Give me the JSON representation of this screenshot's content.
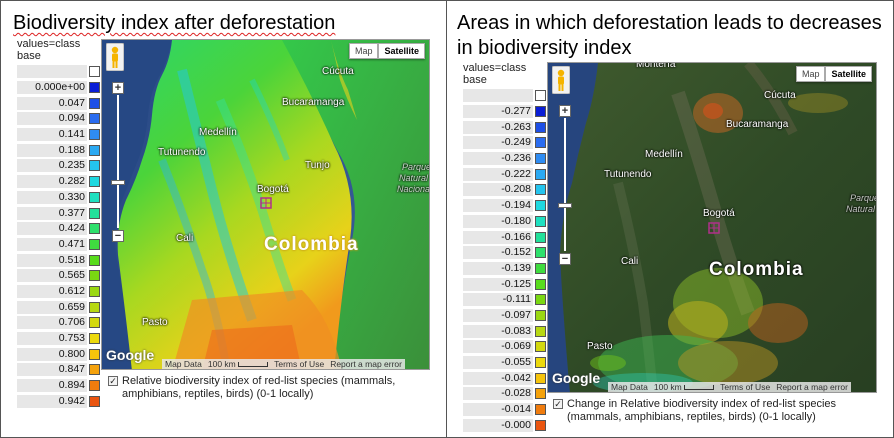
{
  "left_panel": {
    "title": "Biodiversity index after deforestation",
    "legend_header": "values=class base",
    "legend": [
      {
        "value": "",
        "color": "#ffffff"
      },
      {
        "value": "0.000e+00",
        "color": "#0a1ed6"
      },
      {
        "value": "0.047",
        "color": "#1e4fe6"
      },
      {
        "value": "0.094",
        "color": "#2a6cf0"
      },
      {
        "value": "0.141",
        "color": "#2f8cf2"
      },
      {
        "value": "0.188",
        "color": "#2aa9f2"
      },
      {
        "value": "0.235",
        "color": "#24c4ee"
      },
      {
        "value": "0.282",
        "color": "#1ed8e0"
      },
      {
        "value": "0.330",
        "color": "#1fe0c0"
      },
      {
        "value": "0.377",
        "color": "#22e09a"
      },
      {
        "value": "0.424",
        "color": "#2ee06c"
      },
      {
        "value": "0.471",
        "color": "#3fdc3f"
      },
      {
        "value": "0.518",
        "color": "#58dc1c"
      },
      {
        "value": "0.565",
        "color": "#7ad812"
      },
      {
        "value": "0.612",
        "color": "#9ad812"
      },
      {
        "value": "0.659",
        "color": "#b7d812"
      },
      {
        "value": "0.706",
        "color": "#d3d80e"
      },
      {
        "value": "0.753",
        "color": "#ecd90c"
      },
      {
        "value": "0.800",
        "color": "#f6c40c"
      },
      {
        "value": "0.847",
        "color": "#f5a20c"
      },
      {
        "value": "0.894",
        "color": "#f07c0e"
      },
      {
        "value": "0.942",
        "color": "#ea5510"
      }
    ],
    "map": {
      "type_buttons": [
        "Map",
        "Satellite"
      ],
      "selected_type": "Satellite",
      "cities": [
        "Cúcuta",
        "Bucaramanga",
        "Medellín",
        "Tunjo",
        "Tutunendo",
        "Bogotá",
        "Cali",
        "Pasto"
      ],
      "country": "Colombia",
      "faint_labels": [
        "Parque",
        "Natural",
        "Nacional"
      ],
      "google_logo": "Google",
      "attribution": [
        "Map Data",
        "100 km",
        "Terms of Use",
        "Report a map error"
      ]
    },
    "layer_caption": "Relative biodiversity index of red-list species (mammals, amphibians, reptiles, birds) (0-1 locally)"
  },
  "right_panel": {
    "title": "Areas in which deforestation leads to decreases in biodiversity index",
    "legend_header": "values=class base",
    "legend": [
      {
        "value": "",
        "color": "#ffffff"
      },
      {
        "value": "-0.277",
        "color": "#0a1ed6"
      },
      {
        "value": "-0.263",
        "color": "#1e4fe6"
      },
      {
        "value": "-0.249",
        "color": "#2a6cf0"
      },
      {
        "value": "-0.236",
        "color": "#2f8cf2"
      },
      {
        "value": "-0.222",
        "color": "#2aa9f2"
      },
      {
        "value": "-0.208",
        "color": "#24c4ee"
      },
      {
        "value": "-0.194",
        "color": "#1ed8e0"
      },
      {
        "value": "-0.180",
        "color": "#1fe0c0"
      },
      {
        "value": "-0.166",
        "color": "#22e09a"
      },
      {
        "value": "-0.152",
        "color": "#2ee06c"
      },
      {
        "value": "-0.139",
        "color": "#3fdc3f"
      },
      {
        "value": "-0.125",
        "color": "#58dc1c"
      },
      {
        "value": "-0.111",
        "color": "#7ad812"
      },
      {
        "value": "-0.097",
        "color": "#9ad812"
      },
      {
        "value": "-0.083",
        "color": "#b7d812"
      },
      {
        "value": "-0.069",
        "color": "#d3d80e"
      },
      {
        "value": "-0.055",
        "color": "#ecd90c"
      },
      {
        "value": "-0.042",
        "color": "#f6c40c"
      },
      {
        "value": "-0.028",
        "color": "#f5a20c"
      },
      {
        "value": "-0.014",
        "color": "#f07c0e"
      },
      {
        "value": "-0.000",
        "color": "#ea5510"
      }
    ],
    "map": {
      "type_buttons": [
        "Map",
        "Satellite"
      ],
      "selected_type": "Satellite",
      "cities": [
        "Montería",
        "Cúcuta",
        "Bucaramanga",
        "Medellín",
        "Tutunendo",
        "Bogotá",
        "Cali",
        "Pasto"
      ],
      "country": "Colombia",
      "faint_labels": [
        "Parque",
        "Natural"
      ],
      "google_logo": "Google",
      "attribution": [
        "Map Data",
        "100 km",
        "Terms of Use",
        "Report a map error"
      ]
    },
    "layer_caption": "Change in Relative biodiversity index of red-list species (mammals, amphibians, reptiles, birds) (0-1 locally)"
  }
}
